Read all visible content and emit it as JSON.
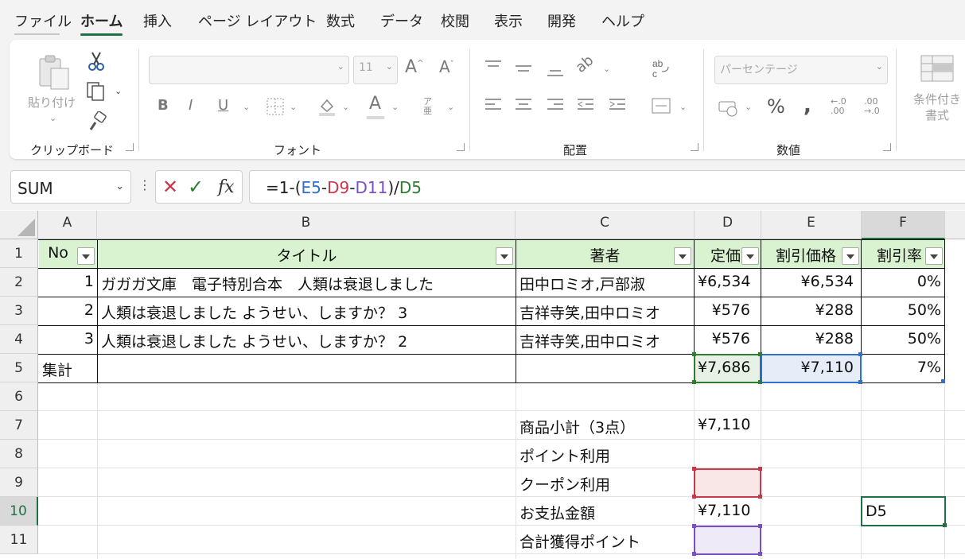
{
  "menu": {
    "tabs": [
      "ファイル",
      "ホーム",
      "挿入",
      "ページ レイアウト",
      "数式",
      "データ",
      "校閲",
      "表示",
      "開発",
      "ヘルプ"
    ],
    "active": "ホーム"
  },
  "ribbon": {
    "clipboard": {
      "label": "クリップボード",
      "paste": "貼り付け"
    },
    "font": {
      "label": "フォント",
      "font_name": "",
      "font_size": "11",
      "furigana": "ア亜"
    },
    "alignment": {
      "label": "配置"
    },
    "number": {
      "label": "数値",
      "format": "パーセンテージ",
      "decrease_decimal": "←.0\n.00",
      "increase_decimal": ".00\n→.0"
    },
    "styles": {
      "conditional": "条件付き\n書式"
    }
  },
  "formula_bar": {
    "name_box": "SUM",
    "formula_prefix": "=1-(",
    "ref_e5": "E5",
    "op1": "-",
    "ref_d9": "D9",
    "op2": "-",
    "ref_d11": "D11",
    "mid": ")/",
    "ref_d5": "D5",
    "fx": "fx"
  },
  "colors": {
    "ref_blue": "#2f6fd0",
    "ref_red": "#c8374a",
    "ref_purple": "#7a4fc4",
    "ref_green": "#2e7d32",
    "header_fill": "#d9f2d0",
    "accent": "#1e7145"
  },
  "sheet": {
    "columns": [
      "A",
      "B",
      "C",
      "D",
      "E",
      "F"
    ],
    "rows": [
      "1",
      "2",
      "3",
      "4",
      "5",
      "6",
      "7",
      "8",
      "9",
      "10",
      "11"
    ],
    "header": {
      "a": "No",
      "b": "タイトル",
      "c": "著者",
      "d": "定価",
      "e": "割引価格",
      "f": "割引率"
    },
    "data": [
      {
        "a": "1",
        "b": "ガガガ文庫　電子特別合本　人類は衰退しました",
        "c": "田中ロミオ,戸部淑",
        "d": "¥6,534",
        "e": "¥6,534",
        "f": "0%"
      },
      {
        "a": "2",
        "b": "人類は衰退しました ようせい、しますか？ 3",
        "c": "吉祥寺笑,田中ロミオ",
        "d": "¥576",
        "e": "¥288",
        "f": "50%"
      },
      {
        "a": "3",
        "b": "人類は衰退しました ようせい、しますか？ 2",
        "c": "吉祥寺笑,田中ロミオ",
        "d": "¥576",
        "e": "¥288",
        "f": "50%"
      }
    ],
    "total": {
      "a": "集計",
      "d": "¥7,686",
      "e": "¥7,110",
      "f": "7%"
    },
    "summary": [
      {
        "label": "商品小計（3点）",
        "value": "¥7,110"
      },
      {
        "label": "ポイント利用",
        "value": ""
      },
      {
        "label": "クーポン利用",
        "value": ""
      },
      {
        "label": "お支払金額",
        "value": "¥7,110"
      },
      {
        "label": "合計獲得ポイント",
        "value": ""
      }
    ],
    "active_cell_text": "D5"
  }
}
